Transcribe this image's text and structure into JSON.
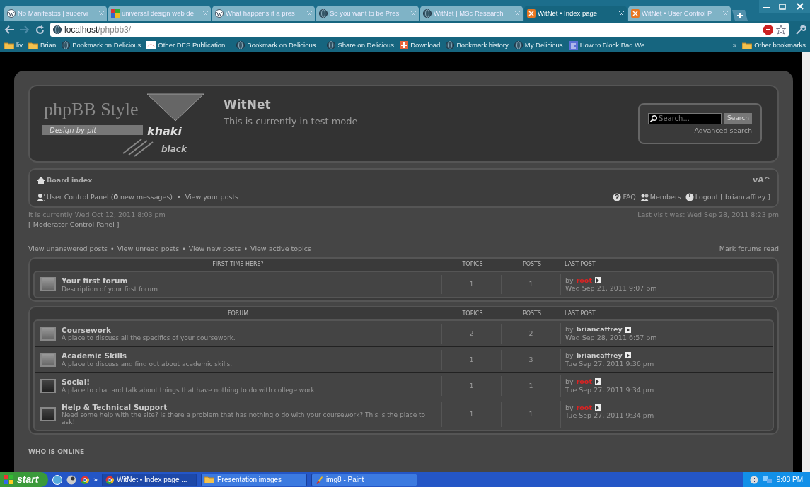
{
  "separator": "•",
  "browser": {
    "tabs": [
      {
        "title": "No Manifestos | supervi",
        "kind": "wp",
        "selected": false
      },
      {
        "title": "universal design web de",
        "kind": "google",
        "selected": false
      },
      {
        "title": "What happens if a pres",
        "kind": "wp",
        "selected": false
      },
      {
        "title": "So you want to be Pres",
        "kind": "globe",
        "selected": false
      },
      {
        "title": "WitNet | MSc Research",
        "kind": "globe",
        "selected": false
      },
      {
        "title": "WitNet • Index page",
        "kind": "xampp",
        "selected": true
      },
      {
        "title": "WitNet • User Control P",
        "kind": "xampp",
        "selected": false
      }
    ],
    "address": {
      "host": "localhost",
      "path": "/phpbb3/"
    },
    "bookmarks": [
      {
        "label": "liv",
        "kind": "folder"
      },
      {
        "label": "Brian",
        "kind": "folder"
      },
      {
        "label": "Bookmark on Delicious",
        "kind": "globe"
      },
      {
        "label": "Other DES Publication...",
        "kind": "image"
      },
      {
        "label": "Bookmark on Delicious...",
        "kind": "globe"
      },
      {
        "label": "Share on Delicious",
        "kind": "globe"
      },
      {
        "label": "Download",
        "kind": "plus"
      },
      {
        "label": "Bookmark history",
        "kind": "globe"
      },
      {
        "label": "My Delicious",
        "kind": "globe"
      },
      {
        "label": "How to Block Bad We...",
        "kind": "square"
      }
    ],
    "overflow": "»",
    "other": "Other bookmarks"
  },
  "site": {
    "logo": {
      "brand": "phpBB Style",
      "credit": "Design by pit",
      "word_1": "khaki",
      "word_2": "black"
    },
    "title": "WitNet",
    "description": "This is currently in test mode",
    "search": {
      "placeholder": "Search...",
      "button": "Search",
      "advanced": "Advanced search"
    }
  },
  "navbar": {
    "board_index": "Board index",
    "font_size": "vA^",
    "ucp": "User Control Panel (**0** new messages)",
    "view_posts": "View your posts",
    "faq": "FAQ",
    "members": "Members",
    "logout": "Logout [ briancaffrey ]"
  },
  "info": {
    "current_time": "It is currently Wed Oct 12, 2011 8:03 pm",
    "moderator_panel": "[ Moderator Control Panel ]",
    "last_visit": "Last visit was: Wed Sep 28, 2011 8:23 pm"
  },
  "quick_links": [
    "View unanswered posts",
    "View unread posts",
    "View new posts",
    "View active topics"
  ],
  "mark_read": "Mark forums read",
  "categories": [
    {
      "header": "FIRST TIME HERE?",
      "columns": [
        "TOPICS",
        "POSTS",
        "LAST POST"
      ],
      "forums": [
        {
          "name": "Your first forum",
          "description": "Description of your first forum.",
          "kind": "light",
          "topics": "1",
          "posts": "1",
          "by": "by",
          "author": "root",
          "color": "#dd2222",
          "time": "Wed Sep 21, 2011 9:07 pm"
        }
      ]
    },
    {
      "header": "FORUM",
      "columns": [
        "TOPICS",
        "POSTS",
        "LAST POST"
      ],
      "forums": [
        {
          "name": "Coursework",
          "description": "A place to discuss all the specifics of your coursework.",
          "kind": "light",
          "topics": "2",
          "posts": "2",
          "by": "by",
          "author": "briancaffrey",
          "color": "#cccccc",
          "time": "Wed Sep 28, 2011 6:57 pm"
        },
        {
          "name": "Academic Skills",
          "description": "A place to discuss and find out about academic skills.",
          "kind": "light",
          "topics": "1",
          "posts": "3",
          "by": "by",
          "author": "briancaffrey",
          "color": "#cccccc",
          "time": "Tue Sep 27, 2011 9:36 pm"
        },
        {
          "name": "Social!",
          "description": "A place to chat and talk about things that have nothing to do with college work.",
          "kind": "dark",
          "topics": "1",
          "posts": "1",
          "by": "by",
          "author": "root",
          "color": "#dd2222",
          "time": "Tue Sep 27, 2011 9:34 pm"
        },
        {
          "name": "Help & Technical Support",
          "description": "Need some help with the site? Is there a problem that has nothing o do with your coursework? This is the place to ask!",
          "kind": "dark",
          "topics": "1",
          "posts": "1",
          "by": "by",
          "author": "root",
          "color": "#dd2222",
          "time": "Tue Sep 27, 2011 9:34 pm"
        }
      ]
    }
  ],
  "who_is_online": "WHO IS ONLINE",
  "taskbar": {
    "start": "start",
    "overflow": "»",
    "tasks": [
      {
        "label": "WitNet • Index page ...",
        "kind": "chrome",
        "selected": true
      },
      {
        "label": "Presentation images",
        "kind": "folder",
        "selected": false
      },
      {
        "label": "img8 - Paint",
        "kind": "paint",
        "selected": false
      }
    ],
    "clock": "9:03 PM"
  }
}
